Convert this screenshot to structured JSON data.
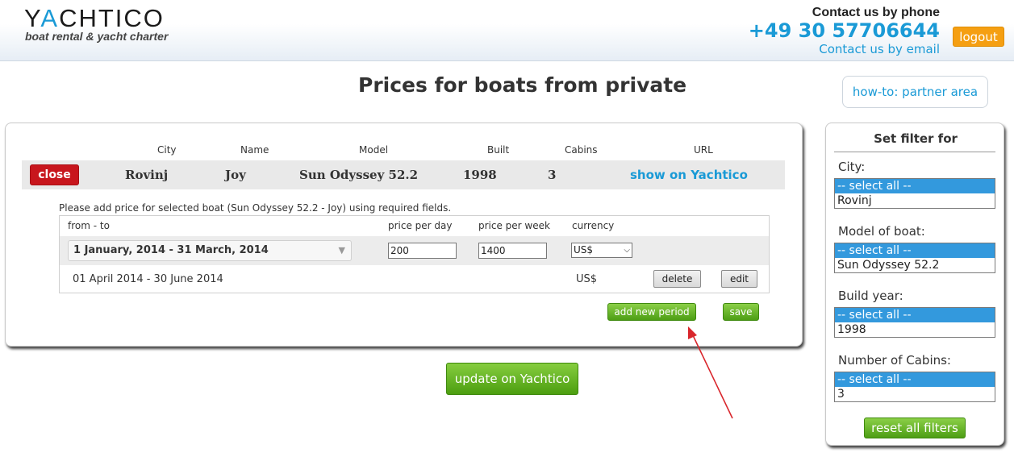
{
  "header": {
    "logo_text_pre": "Y",
    "logo_text_a": "A",
    "logo_text_post": "CHTICO",
    "tagline": "boat rental & yacht charter",
    "contact_title": "Contact us by phone",
    "phone": "+49 30 57706644",
    "email_link": "Contact us by email",
    "logout": "logout"
  },
  "page": {
    "title": "Prices for boats from private",
    "howto": "how-to: partner area"
  },
  "boat": {
    "columns": [
      "City",
      "Name",
      "Model",
      "Built",
      "Cabins",
      "URL"
    ],
    "close_label": "close",
    "city": "Rovinj",
    "name": "Joy",
    "model": "Sun Odyssey 52.2",
    "built": "1998",
    "cabins": "3",
    "link": "show on Yachtico"
  },
  "prices": {
    "instruction": "Please add price for selected boat (Sun Odyssey 52.2 - Joy) using required fields.",
    "headers": {
      "period": "from - to",
      "per_day": "price per day",
      "per_week": "price per week",
      "currency": "currency"
    },
    "edit_row": {
      "period": "1 January, 2014 - 31 March, 2014",
      "per_day": "200",
      "per_week": "1400",
      "currency": "US$"
    },
    "static_row": {
      "period": "01 April 2014 - 30 June 2014",
      "currency": "US$",
      "delete": "delete",
      "edit": "edit"
    },
    "add_period": "add new period",
    "save": "save"
  },
  "update_button": "update on Yachtico",
  "filter": {
    "title": "Set filter for",
    "groups": [
      {
        "label": "City:",
        "selected": "-- select all --",
        "option": "Rovinj"
      },
      {
        "label": "Model of boat:",
        "selected": "-- select all --",
        "option": "Sun Odyssey 52.2"
      },
      {
        "label": "Build year:",
        "selected": "-- select all --",
        "option": "1998"
      },
      {
        "label": "Number of Cabins:",
        "selected": "-- select all --",
        "option": "3"
      }
    ],
    "reset": "reset all filters"
  },
  "colors": {
    "brand_blue": "#1a9ad6",
    "logout_orange": "#f59f12",
    "close_red": "#c8161d",
    "action_green": "#4d9e14",
    "select_highlight": "#3399dd",
    "annotation_arrow": "#d9262c"
  }
}
